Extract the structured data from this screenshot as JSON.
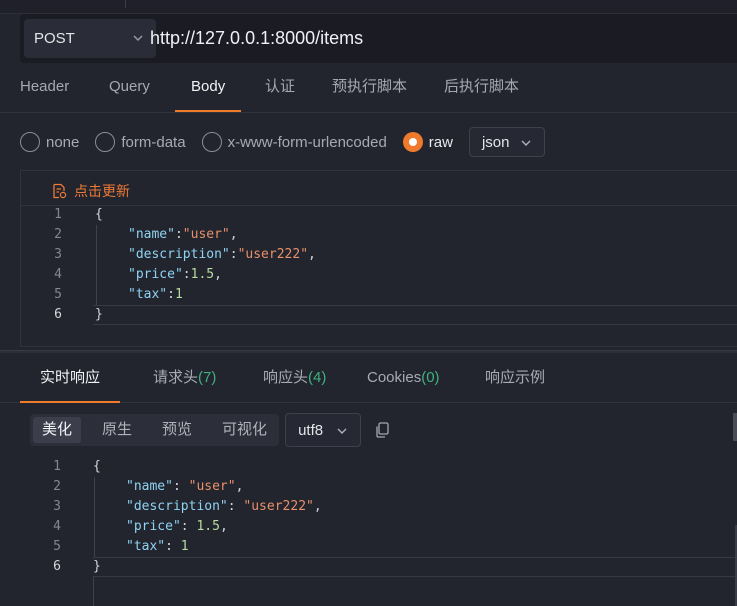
{
  "request": {
    "method": "POST",
    "url": "http://127.0.0.1:8000/items",
    "tabs": [
      "Header",
      "Query",
      "Body",
      "认证",
      "预执行脚本",
      "后执行脚本"
    ],
    "active_tab": "Body",
    "body_types": [
      "none",
      "form-data",
      "x-www-form-urlencoded",
      "raw"
    ],
    "selected_body_type": "raw",
    "format": "json",
    "update_label": "点击更新",
    "lines": [
      [
        "{"
      ],
      [
        "\"name\"",
        ":",
        "\"user\"",
        ","
      ],
      [
        "\"description\"",
        ":",
        "\"user222\"",
        ","
      ],
      [
        "\"price\"",
        ":",
        "1.5",
        ","
      ],
      [
        "\"tax\"",
        ":",
        "1",
        ""
      ],
      [
        "}"
      ]
    ],
    "line_numbers": [
      "1",
      "2",
      "3",
      "4",
      "5",
      "6"
    ]
  },
  "response": {
    "tabs": [
      {
        "label": "实时响应",
        "count": ""
      },
      {
        "label": "请求头",
        "count": "(7)"
      },
      {
        "label": "响应头",
        "count": "(4)"
      },
      {
        "label": "Cookies",
        "count": "(0)"
      },
      {
        "label": "响应示例",
        "count": ""
      }
    ],
    "view_modes": [
      "美化",
      "原生",
      "预览",
      "可视化"
    ],
    "active_view_mode": "美化",
    "encoding": "utf8",
    "lines": [
      [
        "{"
      ],
      [
        "\"name\"",
        ": ",
        "\"user\"",
        ","
      ],
      [
        "\"description\"",
        ": ",
        "\"user222\"",
        ","
      ],
      [
        "\"price\"",
        ": ",
        "1.5",
        ","
      ],
      [
        "\"tax\"",
        ": ",
        "1",
        ""
      ],
      [
        "}"
      ]
    ],
    "line_numbers": [
      "1",
      "2",
      "3",
      "4",
      "5",
      "6"
    ]
  },
  "colors": {
    "accent": "#f07a2c",
    "count_green": "#3fb27f",
    "json_key": "#8fd3f2",
    "json_string": "#e8916a",
    "json_number": "#b7dca0"
  }
}
